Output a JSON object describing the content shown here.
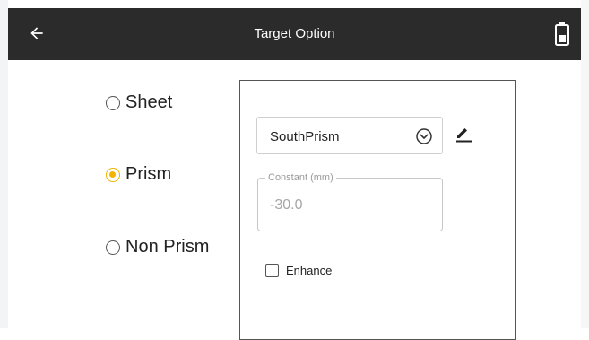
{
  "header": {
    "title": "Target Option",
    "back_icon": "arrow-left-icon",
    "battery_icon": "battery-icon"
  },
  "target_types": {
    "options": [
      {
        "label": "Sheet",
        "selected": false
      },
      {
        "label": "Prism",
        "selected": true
      },
      {
        "label": "Non Prism",
        "selected": false
      }
    ],
    "accent_color": "#f2b400"
  },
  "prism_panel": {
    "prism_select": {
      "value": "SouthPrism",
      "icon": "chevron-down-circle-icon"
    },
    "edit_icon": "pencil-icon",
    "constant": {
      "label": "Constant (mm)",
      "value": "-30.0"
    },
    "enhance": {
      "label": "Enhance",
      "checked": false
    }
  },
  "colors": {
    "appbar": "#2b2b2b",
    "accent": "#f2b400"
  }
}
